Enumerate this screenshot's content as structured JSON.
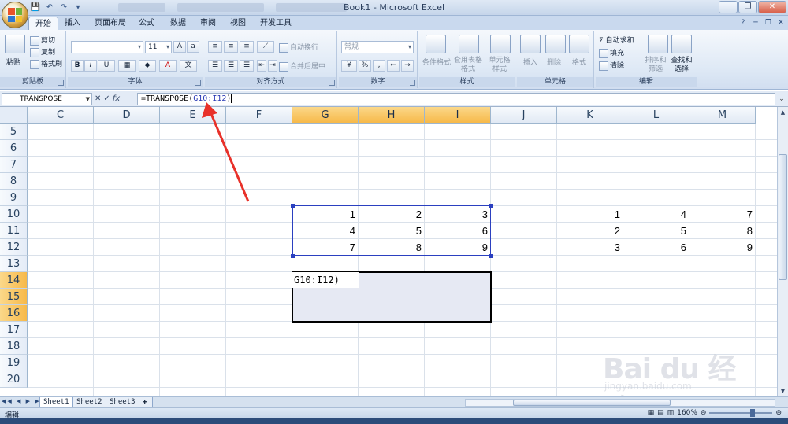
{
  "window": {
    "title": "Book1 - Microsoft Excel",
    "minimize": "─",
    "restore": "❐",
    "close": "✕"
  },
  "tabs": [
    {
      "label": "开始",
      "active": true
    },
    {
      "label": "插入"
    },
    {
      "label": "页面布局"
    },
    {
      "label": "公式"
    },
    {
      "label": "数据"
    },
    {
      "label": "审阅"
    },
    {
      "label": "视图"
    },
    {
      "label": "开发工具"
    }
  ],
  "ribbon": {
    "clipboard": {
      "label": "剪贴板",
      "paste": "粘贴",
      "cut": "剪切",
      "copy": "复制",
      "format_painter": "格式刷"
    },
    "font": {
      "label": "字体",
      "font_name": "",
      "font_size": "11",
      "bold": "B",
      "italic": "I",
      "underline": "U"
    },
    "alignment": {
      "label": "对齐方式",
      "wrap": "自动换行",
      "merge": "合并后居中"
    },
    "number": {
      "label": "数字",
      "format": "常规",
      "percent": "%",
      "comma": ","
    },
    "styles": {
      "label": "样式",
      "conditional": "条件格式",
      "table": "套用表格格式",
      "cell_styles": "单元格样式"
    },
    "cells": {
      "label": "单元格",
      "insert": "插入",
      "delete": "删除",
      "format": "格式"
    },
    "editing": {
      "label": "编辑",
      "autosum": "Σ 自动求和",
      "fill": "填充",
      "clear": "清除",
      "sort": "排序和筛选",
      "find": "查找和选择"
    }
  },
  "formula_bar": {
    "name_box": "TRANSPOSE",
    "cancel": "✕",
    "enter": "✓",
    "fx": "fx",
    "formula_prefix": "=TRANSPOSE(",
    "formula_ref": "G10:I12",
    "formula_suffix": ")"
  },
  "columns": [
    "C",
    "D",
    "E",
    "F",
    "G",
    "H",
    "I",
    "J",
    "K",
    "L",
    "M"
  ],
  "selected_columns": [
    "G",
    "H",
    "I"
  ],
  "rows": [
    "5",
    "6",
    "7",
    "8",
    "9",
    "10",
    "11",
    "12",
    "13",
    "14",
    "15",
    "16",
    "17",
    "18",
    "19",
    "20"
  ],
  "selected_rows": [
    "14",
    "15",
    "16"
  ],
  "cells": {
    "G10": "1",
    "H10": "2",
    "I10": "3",
    "G11": "4",
    "H11": "5",
    "I11": "6",
    "G12": "7",
    "H12": "8",
    "I12": "9",
    "K10": "1",
    "L10": "4",
    "M10": "7",
    "K11": "2",
    "L11": "5",
    "M11": "8",
    "K12": "3",
    "L12": "6",
    "M12": "9"
  },
  "edit_cell_text": "G10:I12)",
  "sheets": [
    {
      "label": "Sheet1",
      "active": true
    },
    {
      "label": "Sheet2"
    },
    {
      "label": "Sheet3"
    }
  ],
  "status": {
    "mode": "编辑",
    "zoom": "160%"
  },
  "watermark": {
    "text": "Bai du 经验",
    "url": "jingyan.baidu.com"
  },
  "colors": {
    "accent": "#2b40c0",
    "selection_header": "#f7b949",
    "arrow": "#e8312a"
  }
}
